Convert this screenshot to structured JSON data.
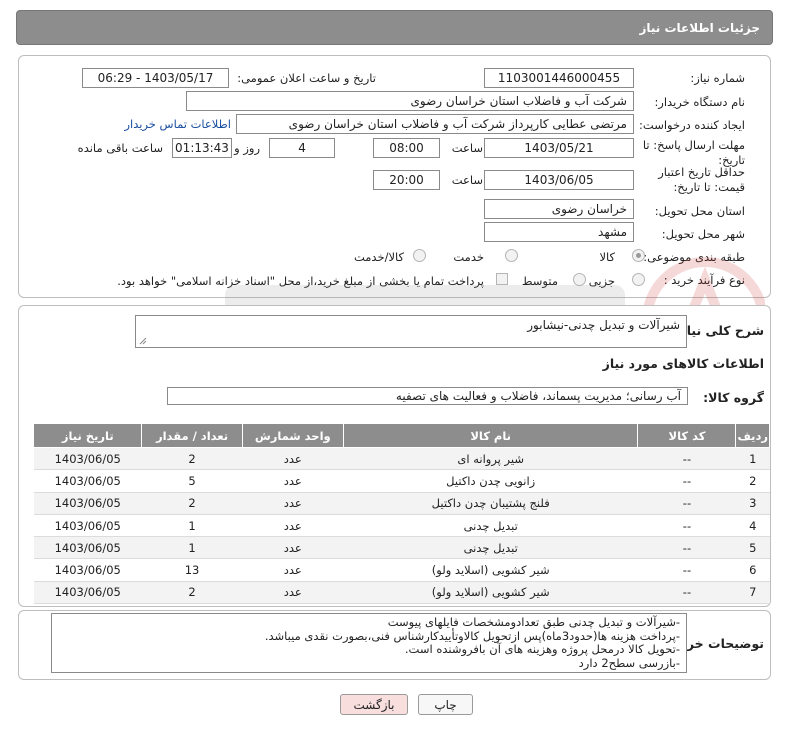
{
  "header": {
    "title": "جزئیات اطلاعات نیاز"
  },
  "form": {
    "need_number_label": "شماره نیاز:",
    "need_number": "1103001446000455",
    "announce_label": "تاریخ و ساعت اعلان عمومی:",
    "announce_value": "1403/05/17 - 06:29",
    "buyer_org_label": "نام دستگاه خریدار:",
    "buyer_org": "شرکت آب و فاضلاب استان خراسان رضوی",
    "requester_label": "ایجاد کننده درخواست:",
    "requester": "مرتضی عطایی کارپرداز شرکت آب و فاضلاب استان خراسان رضوی",
    "contact_link": "اطلاعات تماس خریدار",
    "deadline_label": "مهلت ارسال پاسخ: تا تاریخ:",
    "deadline_date": "1403/05/21",
    "time_label": "ساعت",
    "deadline_time": "08:00",
    "days_value": "4",
    "days_label": "روز و",
    "remaining_time": "01:13:43",
    "remaining_label": "ساعت باقی مانده",
    "validity_label": "حداقل تاریخ اعتبار قیمت: تا تاریخ:",
    "validity_date": "1403/06/05",
    "validity_time": "20:00",
    "province_label": "استان محل تحویل:",
    "province": "خراسان رضوی",
    "city_label": "شهر محل تحویل:",
    "city": "مشهد",
    "category_label": "طبقه بندی موضوعی:",
    "category_options": [
      "کالا",
      "خدمت",
      "کالا/خدمت"
    ],
    "process_label": "نوع فرآیند خرید :",
    "process_options": [
      "جزیی",
      "متوسط"
    ],
    "process_note": "پرداخت تمام یا بخشی از مبلغ خرید،از محل \"اسناد خزانه اسلامی\" خواهد بود."
  },
  "details": {
    "summary_label": "شرح کلی نیاز:",
    "summary": "شیرآلات و تبدیل چدنی-نیشابور",
    "goods_title": "اطلاعات کالاهای مورد نیاز",
    "group_label": "گروه کالا:",
    "group_value": "آب رسانی؛ مدیریت پسماند، فاضلاب و فعالیت های تصفیه"
  },
  "table": {
    "headers": [
      "ردیف",
      "کد کالا",
      "نام کالا",
      "واحد شمارش",
      "تعداد / مقدار",
      "تاریخ نیاز"
    ],
    "rows": [
      [
        "1",
        "--",
        "شیر پروانه ای",
        "عدد",
        "2",
        "1403/06/05"
      ],
      [
        "2",
        "--",
        "زانویی چدن داکتیل",
        "عدد",
        "5",
        "1403/06/05"
      ],
      [
        "3",
        "--",
        "فلنج پشتیبان چدن داکتیل",
        "عدد",
        "2",
        "1403/06/05"
      ],
      [
        "4",
        "--",
        "تبدیل چدنی",
        "عدد",
        "1",
        "1403/06/05"
      ],
      [
        "5",
        "--",
        "تبدیل چدنی",
        "عدد",
        "1",
        "1403/06/05"
      ],
      [
        "6",
        "--",
        "شیر کشویی (اسلاید ولو)",
        "عدد",
        "13",
        "1403/06/05"
      ],
      [
        "7",
        "--",
        "شیر کشویی (اسلاید ولو)",
        "عدد",
        "2",
        "1403/06/05"
      ]
    ]
  },
  "buyer_notes": {
    "label": "توضیحات خریدار:",
    "lines": [
      "-شیرآلات و تبدیل چدنی طبق تعدادومشخصات فایلهای پیوست",
      "-پرداخت هزینه ها(حدود3ماه)پس ازتحویل کالاوتأییدکارشناس فنی،بصورت نقدی میباشد.",
      "-تحویل کالا درمحل پروژه وهزینه های آن بافروشنده است.",
      "-بازرسی سطح2 دارد"
    ]
  },
  "buttons": {
    "print": "چاپ",
    "back": "بازگشت"
  },
  "colors": {
    "header_bg": "#8d8d8d",
    "link": "#1a4fa0",
    "back_btn_bg": "#f9dede"
  }
}
